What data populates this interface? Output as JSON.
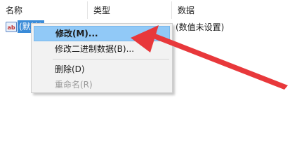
{
  "columns": {
    "name": "名称",
    "type": "类型",
    "data": "数据"
  },
  "row": {
    "icon": "string-value-icon",
    "icon_text": "ab",
    "name": "(默认)",
    "data": "(数值未设置)"
  },
  "context_menu": {
    "items": [
      {
        "label": "修改(M)...",
        "highlighted": true,
        "disabled": false
      },
      {
        "label": "修改二进制数据(B)...",
        "highlighted": false,
        "disabled": false
      },
      {
        "label": "删除(D)",
        "highlighted": false,
        "disabled": false
      },
      {
        "label": "重命名(R)",
        "highlighted": false,
        "disabled": true
      }
    ]
  },
  "colors": {
    "selection": "#3a8bd8",
    "menu_highlight": "#91c9f7",
    "annotation_arrow": "#e8383b"
  }
}
